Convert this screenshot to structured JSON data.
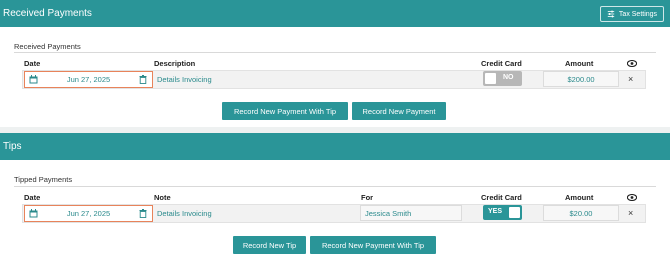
{
  "received": {
    "header_title": "Received Payments",
    "tax_settings_label": "Tax Settings",
    "panel_label": "Received Payments",
    "columns": {
      "date": "Date",
      "description": "Description",
      "credit_card": "Credit Card",
      "amount": "Amount"
    },
    "row": {
      "date": "Jun 27, 2025",
      "description": "Details Invoicing",
      "credit_card": "NO",
      "amount": "$200.00",
      "remove": "×"
    },
    "buttons": {
      "new_with_tip": "Record New Payment With Tip",
      "new_payment": "Record New Payment"
    }
  },
  "tips": {
    "header_title": "Tips",
    "panel_label": "Tipped Payments",
    "columns": {
      "date": "Date",
      "note": "Note",
      "for": "For",
      "credit_card": "Credit Card",
      "amount": "Amount"
    },
    "row": {
      "date": "Jun 27, 2025",
      "note": "Details Invoicing",
      "for": "Jessica Smith",
      "credit_card": "YES",
      "amount": "$20.00",
      "remove": "×"
    },
    "buttons": {
      "new_tip": "Record New Tip",
      "new_with_tip": "Record New Payment With Tip"
    }
  },
  "colors": {
    "accent": "#2a9598",
    "link": "#2a8a8c",
    "date_border": "#e8835a"
  },
  "icons": [
    "sliders-icon",
    "calendar-icon",
    "trash-icon",
    "eye-icon",
    "close-icon"
  ]
}
